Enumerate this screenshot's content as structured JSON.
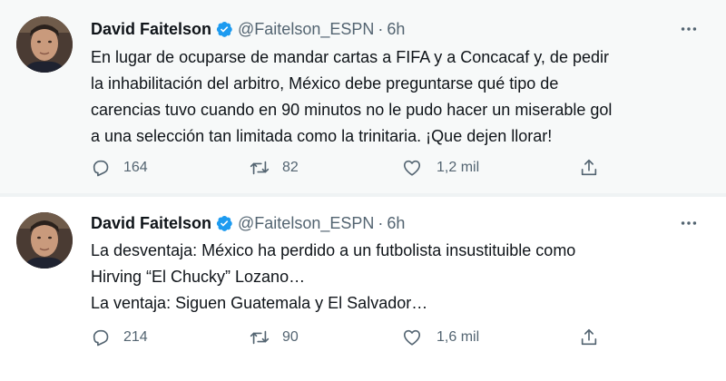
{
  "tweets": [
    {
      "author_name": "David Faitelson",
      "handle": "@Faitelson_ESPN",
      "time": "6h",
      "lines": [
        "En lugar de ocuparse de mandar cartas a FIFA y a Concacaf y, de pedir",
        "la inhabilitación del arbitro, México debe preguntarse qué tipo de",
        "carencias tuvo cuando en 90 minutos no le pudo hacer un miserable gol",
        "a una selección tan limitada como la trinitaria. ¡Que dejen llorar!"
      ],
      "replies": "164",
      "retweets": "82",
      "likes": "1,2 mil"
    },
    {
      "author_name": "David Faitelson",
      "handle": "@Faitelson_ESPN",
      "time": "6h",
      "lines": [
        "La desventaja: México ha perdido a un futbolista insustituible como",
        "Hirving “El Chucky” Lozano…",
        "La ventaja: Siguen Guatemala y El Salvador…"
      ],
      "replies": "214",
      "retweets": "90",
      "likes": "1,6 mil"
    }
  ],
  "icons": {
    "verified": "verified-badge-icon",
    "more": "more-options-icon",
    "reply": "reply-icon",
    "retweet": "retweet-icon",
    "like": "like-icon",
    "share": "share-icon"
  },
  "colors": {
    "verified": "#1d9bf0",
    "secondary_text": "#536471",
    "primary_text": "#0f1419",
    "hover_background": "#f7f9f9"
  }
}
